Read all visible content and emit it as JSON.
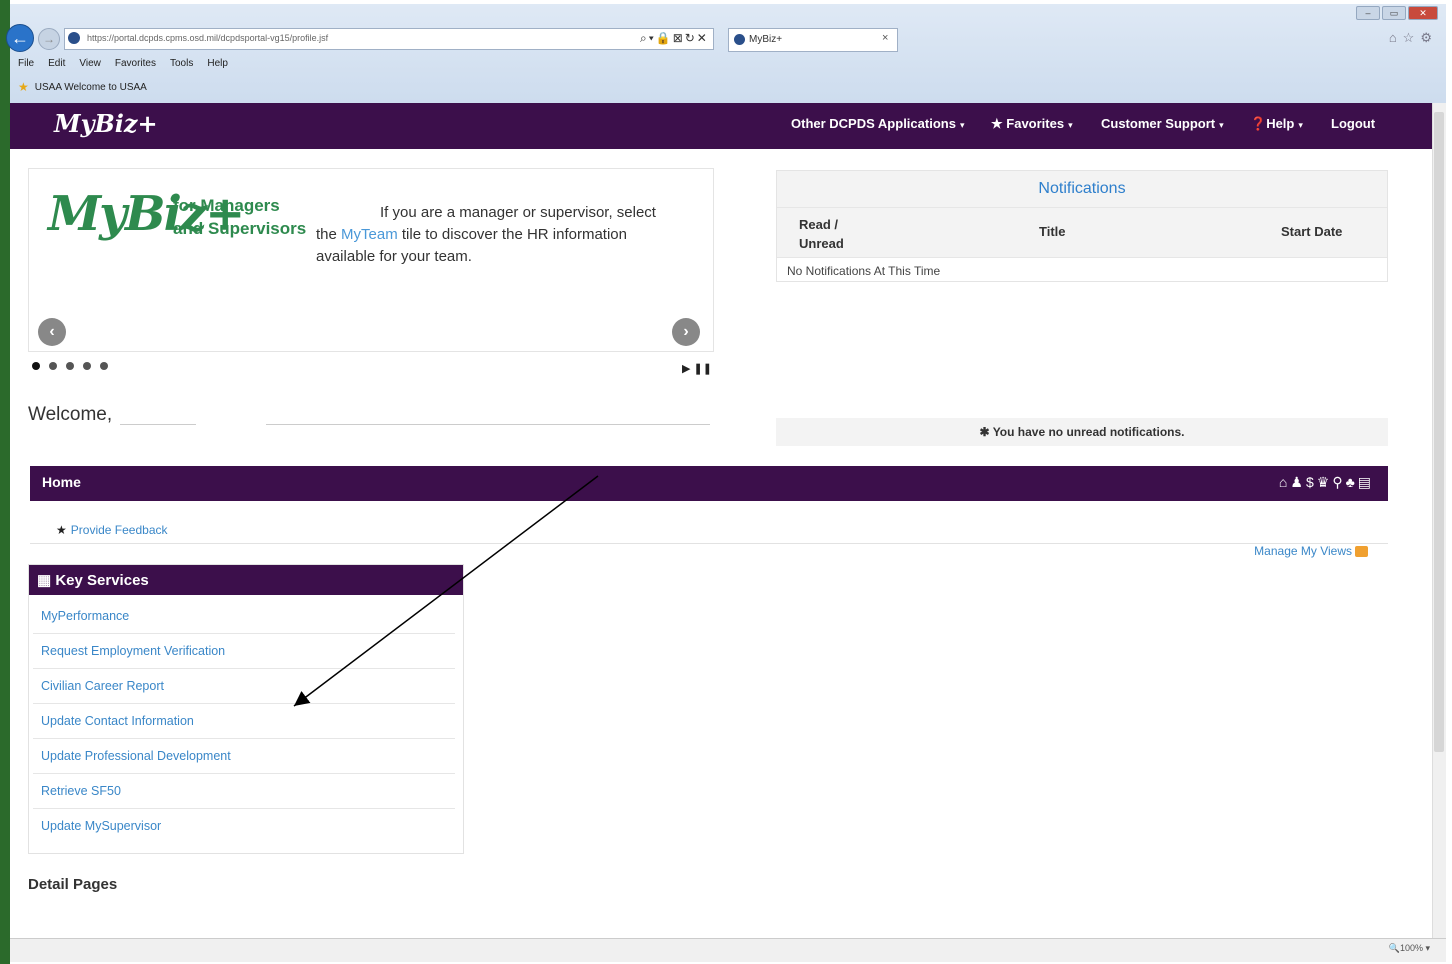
{
  "browser": {
    "url": "https://portal.dcpds.cpms.osd.mil/dcpdsportal-vg15/profile.jsf",
    "tab_title": "MyBiz+",
    "menu": [
      "File",
      "Edit",
      "View",
      "Favorites",
      "Tools",
      "Help"
    ],
    "favorites_bar_item": "USAA  Welcome to USAA",
    "zoom": "100%"
  },
  "header": {
    "logo": "MyBiz+",
    "nav": [
      {
        "label": "Other DCPDS Applications",
        "has_caret": true
      },
      {
        "label": "Favorites",
        "icon": "star-icon",
        "has_caret": true
      },
      {
        "label": "Customer Support",
        "has_caret": true
      },
      {
        "label": "Help",
        "icon": "question-circle-icon",
        "has_caret": true
      },
      {
        "label": "Logout",
        "has_caret": false
      }
    ]
  },
  "carousel": {
    "brand": "MyBiz+",
    "brand_sub_1": "for Managers",
    "brand_sub_2": "and Supervisors",
    "text_1": "If you are a manager or supervisor, select",
    "text_2a": "the",
    "text_link": "MyTeam",
    "text_2b": "tile to discover the HR information",
    "text_3": "available for your team.",
    "slide_count": 5,
    "active_slide": 1
  },
  "welcome": "Welcome,",
  "notifications": {
    "title": "Notifications",
    "columns": [
      "Read / Unread",
      "Title",
      "Start Date"
    ],
    "empty_text": "No Notifications At This Time",
    "footer": "You have no unread notifications."
  },
  "home": {
    "label": "Home",
    "icons": [
      "home-icon",
      "user-icon",
      "dollar-icon",
      "graduation-icon",
      "person-icon",
      "thumbs-up-icon",
      "document-icon"
    ]
  },
  "feedback_link": "Provide Feedback",
  "manage_views_link": "Manage My Views",
  "key_services": {
    "title": "Key Services",
    "items": [
      "MyPerformance",
      "Request Employment Verification",
      "Civilian Career Report",
      "Update Contact Information",
      "Update Professional Development",
      "Retrieve SF50",
      "Update MySupervisor"
    ]
  },
  "detail_pages": "Detail Pages"
}
